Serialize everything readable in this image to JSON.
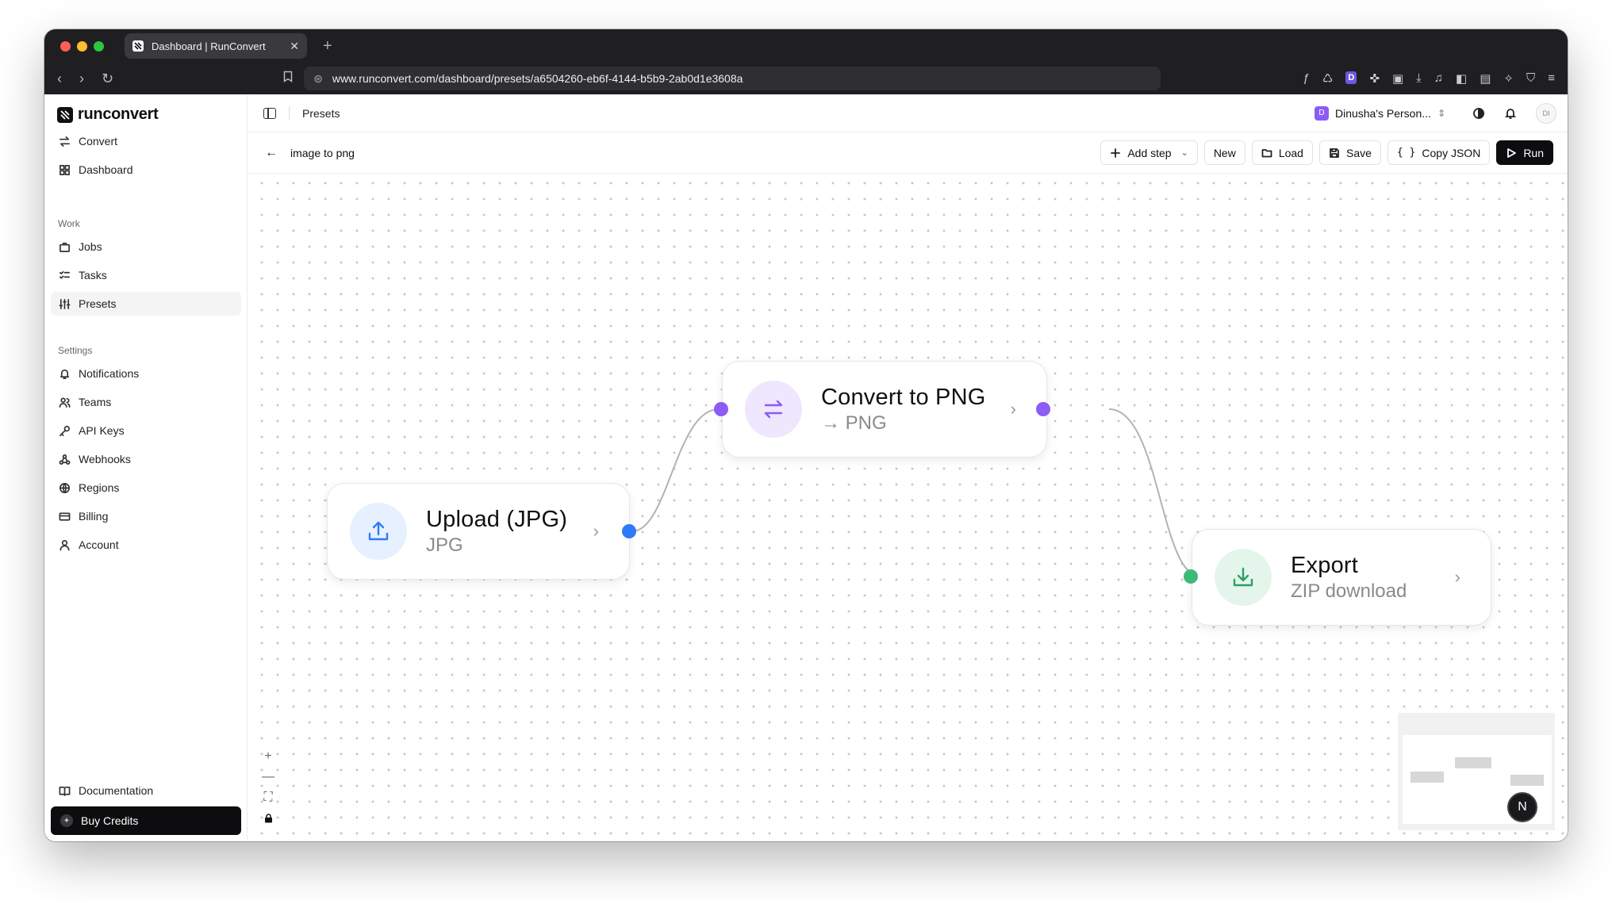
{
  "browser": {
    "tab_title": "Dashboard | RunConvert",
    "url": "www.runconvert.com/dashboard/presets/a6504260-eb6f-4144-b5b9-2ab0d1e3608a",
    "ext_badge": "D"
  },
  "sidebar": {
    "brand": "runconvert",
    "primary": [
      {
        "label": "Convert",
        "icon": "arrows-swap-icon"
      },
      {
        "label": "Dashboard",
        "icon": "grid-icon"
      }
    ],
    "work_label": "Work",
    "work": [
      {
        "label": "Jobs",
        "icon": "briefcase-icon"
      },
      {
        "label": "Tasks",
        "icon": "list-check-icon"
      },
      {
        "label": "Presets",
        "icon": "sliders-icon",
        "active": true
      }
    ],
    "settings_label": "Settings",
    "settings": [
      {
        "label": "Notifications",
        "icon": "bell-icon"
      },
      {
        "label": "Teams",
        "icon": "users-icon"
      },
      {
        "label": "API Keys",
        "icon": "key-icon"
      },
      {
        "label": "Webhooks",
        "icon": "webhook-icon"
      },
      {
        "label": "Regions",
        "icon": "globe-icon"
      },
      {
        "label": "Billing",
        "icon": "card-icon"
      },
      {
        "label": "Account",
        "icon": "user-icon"
      }
    ],
    "documentation": "Documentation",
    "buy_credits": "Buy Credits"
  },
  "topbar": {
    "breadcrumb": "Presets",
    "workspace_initial": "D",
    "workspace_name": "Dinusha's Person...",
    "avatar_initials": "DI"
  },
  "editor": {
    "preset_name": "image to png",
    "add_step": "Add step",
    "new": "New",
    "load": "Load",
    "save": "Save",
    "copy_json": "Copy JSON",
    "run": "Run"
  },
  "nodes": {
    "upload": {
      "title": "Upload (JPG)",
      "subtitle": "JPG",
      "accent": "#2f7cf6"
    },
    "convert": {
      "title": "Convert to PNG",
      "subtitle": "→ PNG",
      "accent": "#8b5cf6"
    },
    "export": {
      "title": "Export",
      "subtitle": "ZIP download",
      "accent": "#3dba7a"
    }
  },
  "canvas": {
    "zoom_in": "+",
    "zoom_out": "—",
    "assistant_badge": "N"
  }
}
